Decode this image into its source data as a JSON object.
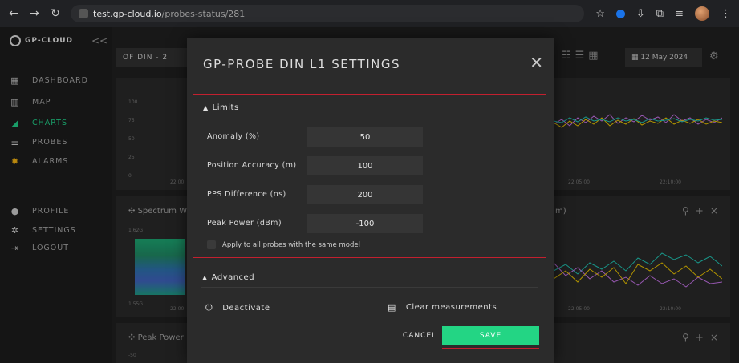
{
  "browser": {
    "host": "test.gp-cloud.io",
    "path": "/probes-status/281"
  },
  "sidebar": {
    "logo": "GP-CLOUD",
    "collapse": "<<",
    "items": [
      {
        "label": "DASHBOARD",
        "icon": "dashboard-icon"
      },
      {
        "label": "MAP",
        "icon": "map-icon"
      },
      {
        "label": "CHARTS",
        "icon": "charts-icon",
        "active": true
      },
      {
        "label": "PROBES",
        "icon": "list-icon"
      },
      {
        "label": "ALARMS",
        "icon": "alarm-icon"
      },
      {
        "label": "PROFILE",
        "icon": "user-icon"
      },
      {
        "label": "SETTINGS",
        "icon": "gear-icon"
      },
      {
        "label": "LOGOUT",
        "icon": "logout-icon"
      }
    ]
  },
  "toolbar": {
    "probe_select": "OF DIN - 2",
    "date": "12 May 2024"
  },
  "background_panels": {
    "top_ticks": [
      "100",
      "75",
      "50",
      "25",
      "0"
    ],
    "time_a": "22:00",
    "time_b": "22:05:00",
    "time_c": "22:10:00",
    "spectrum_title": "Spectrum W",
    "spectrum_hi": "1.62G",
    "spectrum_lo": "1.55G",
    "right_title_fragment": "m)",
    "peak_title": "Peak Power",
    "peak_tick": "-50"
  },
  "modal": {
    "title": "GP-PROBE DIN L1 SETTINGS",
    "limits": {
      "heading": "Limits",
      "fields": [
        {
          "label": "Anomaly (%)",
          "value": "50"
        },
        {
          "label": "Position Accuracy (m)",
          "value": "100"
        },
        {
          "label": "PPS Difference (ns)",
          "value": "200"
        },
        {
          "label": "Peak Power (dBm)",
          "value": "-100"
        }
      ],
      "apply_all": "Apply to all probes with the same model"
    },
    "advanced": {
      "heading": "Advanced",
      "deactivate": "Deactivate",
      "clear": "Clear measurements"
    },
    "cancel": "CANCEL",
    "save": "SAVE"
  },
  "colors": {
    "accent_green": "#23d584",
    "highlight_red": "#c3202f",
    "alarm_yellow": "#e3a712"
  }
}
